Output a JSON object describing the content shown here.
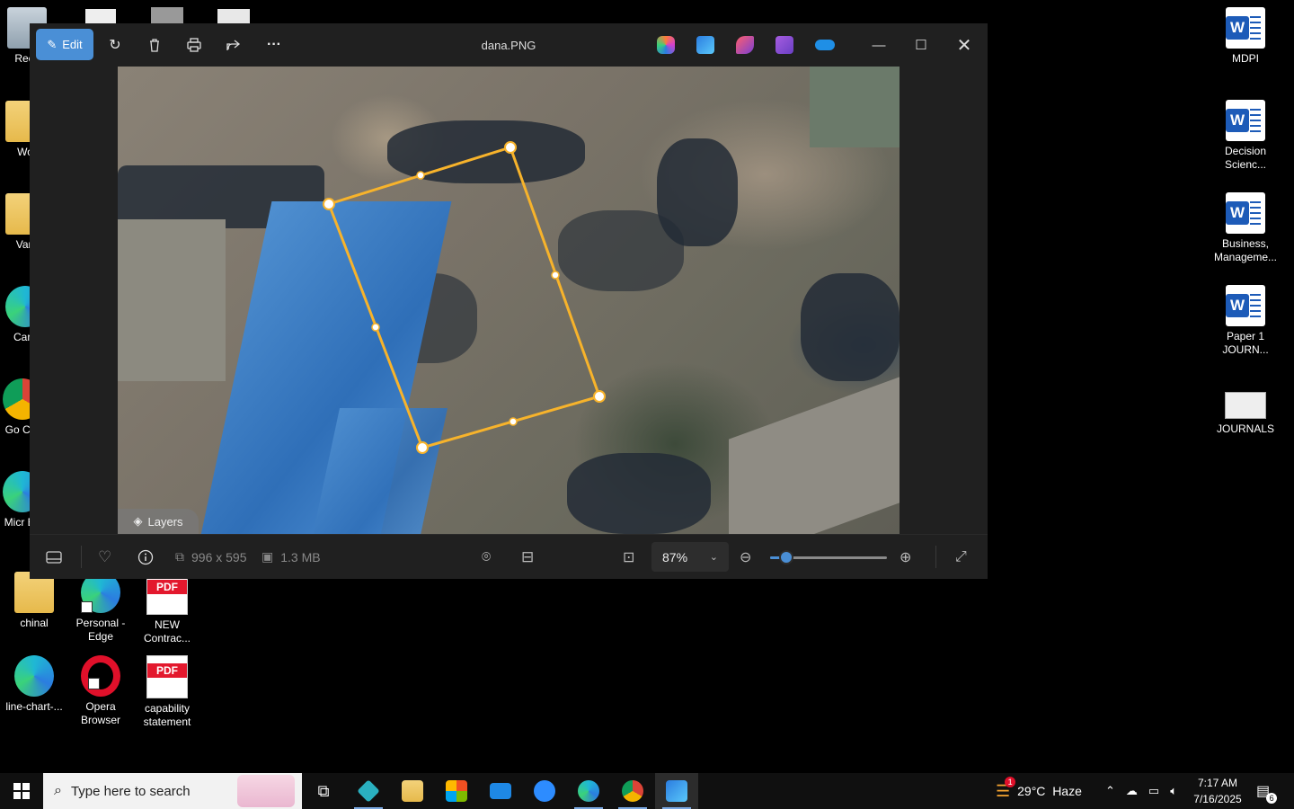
{
  "desktop_left": [
    {
      "label": "Recy",
      "kind": "bin"
    },
    {
      "label": "Wo",
      "kind": "folder"
    },
    {
      "label": "Vari",
      "kind": "folder"
    },
    {
      "label": "Care",
      "kind": "edge"
    },
    {
      "label": "Go Chr",
      "kind": "chrome"
    },
    {
      "label": "Micr Ed",
      "kind": "edge"
    }
  ],
  "desktop_bottom": [
    {
      "label": "chinal",
      "kind": "folder"
    },
    {
      "label": "Personal - Edge",
      "kind": "edge"
    },
    {
      "label": "NEW Contrac...",
      "kind": "pdf"
    },
    {
      "label": "line-chart-...",
      "kind": "edge"
    },
    {
      "label": "Opera Browser",
      "kind": "opera"
    },
    {
      "label": "capability statement",
      "kind": "pdf"
    }
  ],
  "desktop_right": [
    {
      "label": "MDPI"
    },
    {
      "label": "Decision Scienc..."
    },
    {
      "label": "Business, Manageme..."
    },
    {
      "label": "Paper 1 JOURN..."
    },
    {
      "label": "JOURNALS"
    }
  ],
  "pdf_tag": "PDF",
  "word_letter": "W",
  "photos": {
    "title": "dana.PNG",
    "edit_label": "Edit",
    "more_label": "···",
    "layers_label": "Layers",
    "dimensions": "996 x 595",
    "file_size": "1.3 MB",
    "zoom_label": "87%",
    "zoom_level": 0.14
  },
  "taskbar": {
    "search_placeholder": "Type here to search",
    "weather": "29°C  Haze",
    "weather_badge": "1",
    "time": "7:17 AM",
    "date": "7/16/2025",
    "notifications": "6"
  },
  "colors": {
    "accent": "#4a8fd6",
    "selection": "#f7b32b",
    "window_bg": "#202020"
  }
}
